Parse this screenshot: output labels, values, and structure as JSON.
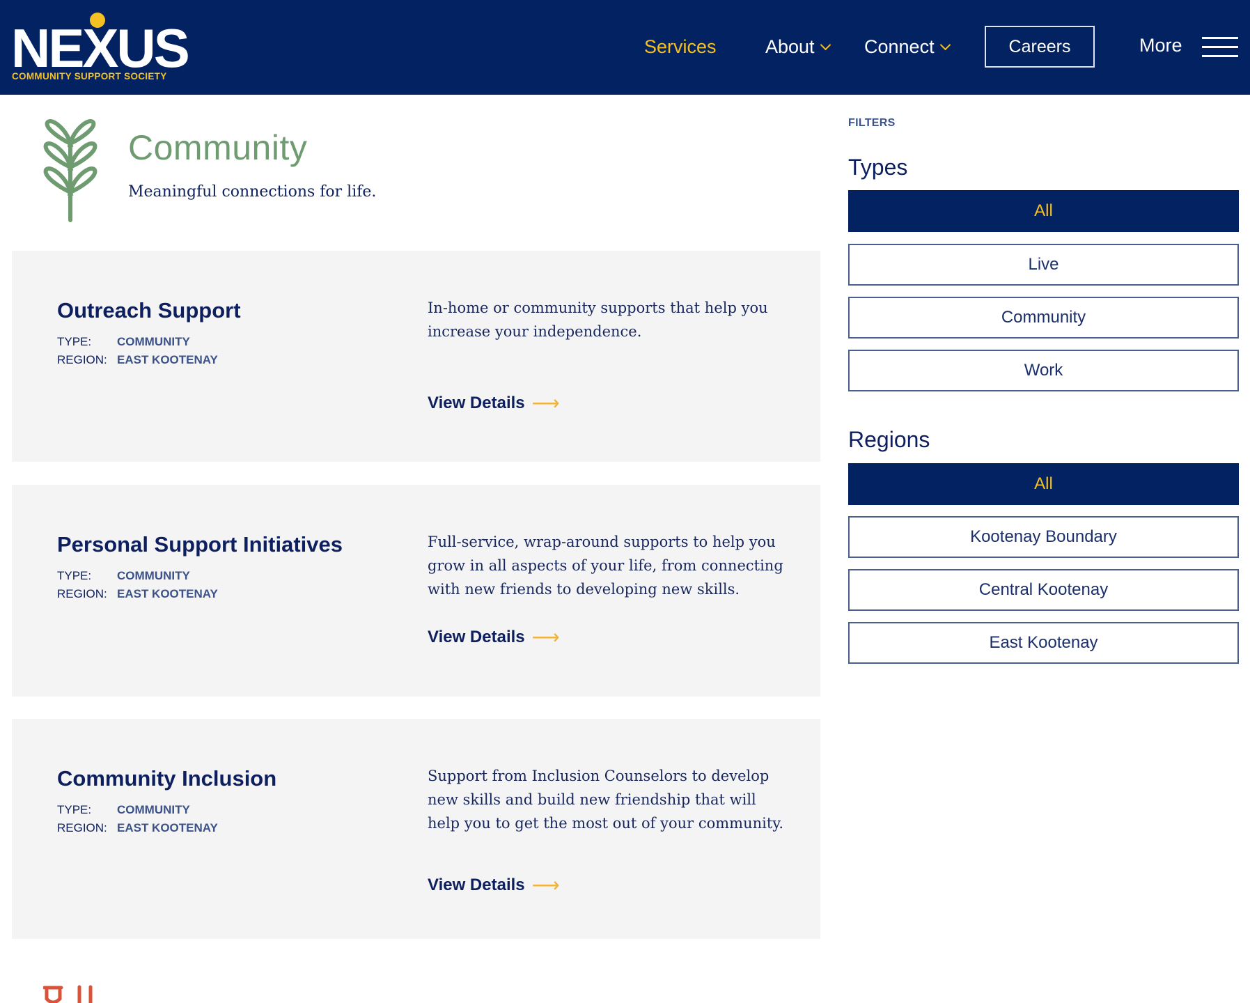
{
  "header": {
    "logo_text": "NEXUS",
    "logo_subtitle": "COMMUNITY SUPPORT SOCIETY",
    "nav": [
      {
        "label": "Services",
        "active": true,
        "has_dropdown": false
      },
      {
        "label": "About",
        "active": false,
        "has_dropdown": true
      },
      {
        "label": "Connect",
        "active": false,
        "has_dropdown": true
      }
    ],
    "careers_label": "Careers",
    "more_label": "More",
    "menu_icon": "hamburger-icon"
  },
  "hero": {
    "icon": "leaf-icon",
    "title": "Community",
    "subtitle": "Meaningful connections for life."
  },
  "meta_labels": {
    "type": "TYPE:",
    "region": "REGION:"
  },
  "services": [
    {
      "title": "Outreach Support",
      "type": "COMMUNITY",
      "region": "EAST KOOTENAY",
      "description": "In-home or community supports that help you increase your independence.",
      "link_label": "View Details",
      "link_icon": "arrow-right-icon"
    },
    {
      "title": "Personal Support Initiatives",
      "type": "COMMUNITY",
      "region": "EAST KOOTENAY",
      "description": "Full-service, wrap-around supports to help you grow in all aspects of your life, from connecting with new friends to developing new skills.",
      "link_label": "View Details",
      "link_icon": "arrow-right-icon"
    },
    {
      "title": "Community Inclusion",
      "type": "COMMUNITY",
      "region": "EAST KOOTENAY",
      "description": "Support from Inclusion Counselors to develop new skills and build new friendship that will help you to get the most out of your community.",
      "link_label": "View Details",
      "link_icon": "arrow-right-icon"
    }
  ],
  "filters": {
    "label": "FILTERS",
    "types": {
      "heading": "Types",
      "options": [
        {
          "label": "All",
          "selected": true
        },
        {
          "label": "Live",
          "selected": false
        },
        {
          "label": "Community",
          "selected": false
        },
        {
          "label": "Work",
          "selected": false
        }
      ]
    },
    "regions": {
      "heading": "Regions",
      "options": [
        {
          "label": "All",
          "selected": true
        },
        {
          "label": "Kootenay Boundary",
          "selected": false
        },
        {
          "label": "Central Kootenay",
          "selected": false
        },
        {
          "label": "East Kootenay",
          "selected": false
        }
      ]
    }
  },
  "colors": {
    "navy": "#032262",
    "gold": "#f5c021",
    "green": "#6f9b70",
    "card_bg": "#f4f4f4",
    "accent_orange": "#d9533a"
  }
}
